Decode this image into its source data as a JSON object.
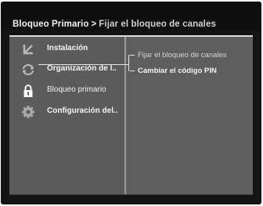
{
  "header": {
    "title_main": "Bloqueo Primario",
    "separator": ">",
    "title_sub": "Fijar el bloqueo de canales"
  },
  "menu": {
    "items": [
      {
        "label": "Instalación",
        "icon": "arrow-down-left-icon"
      },
      {
        "label": "Organización de l..",
        "icon": "circular-arrows-icon"
      },
      {
        "label": "Bloqueo primario",
        "icon": "padlock-icon"
      },
      {
        "label": "Configuración del..",
        "icon": "gear-icon"
      }
    ],
    "selected_index": 2
  },
  "submenu": {
    "items": [
      {
        "label": "Fijar el bloqueo de canales"
      },
      {
        "label": "Cambiar el código PIN"
      }
    ]
  },
  "colors": {
    "screen_bg": "#141414",
    "panel_bg": "#5b5b5b",
    "divider": "#9c9c9c",
    "text": "#f4f4f4"
  }
}
